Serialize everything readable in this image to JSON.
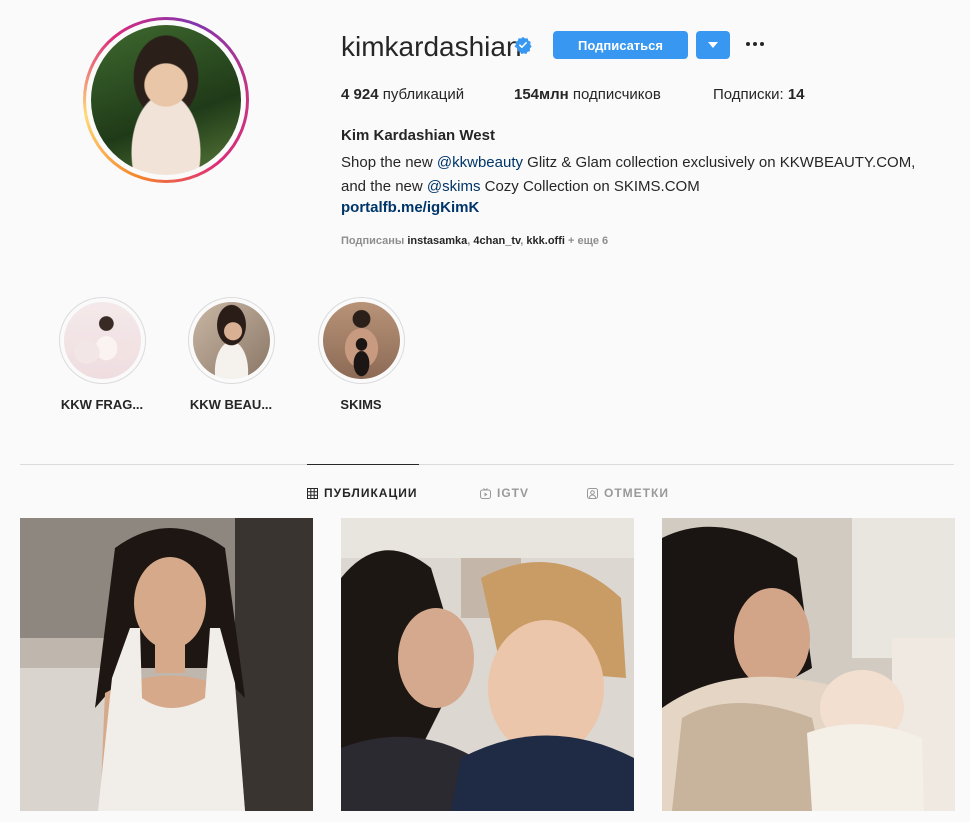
{
  "profile": {
    "username": "kimkardashian",
    "follow_label": "Подписаться",
    "stats": {
      "posts_count": "4 924",
      "posts_label": "публикаций",
      "followers_count": "154млн",
      "followers_label": "подписчиков",
      "following_label": "Подписки:",
      "following_count": "14"
    },
    "full_name": "Kim Kardashian West",
    "bio": {
      "line1_pre": "Shop the new ",
      "line1_mention": "@kkwbeauty",
      "line1_post": " Glitz & Glam collection exclusively on KKWBEAUTY.COM,",
      "line2_pre": "and the new ",
      "line2_mention": "@skims",
      "line2_post": " Cozy Collection on SKIMS.COM"
    },
    "link": "portalfb.me/igKimK",
    "followed_by": {
      "prefix": "Подписаны",
      "accounts": [
        "instasamka",
        "4chan_tv",
        "kkk.offi"
      ],
      "more": "+ еще 6"
    }
  },
  "highlights": [
    {
      "label": "KKW FRAG..."
    },
    {
      "label": "KKW BEAU..."
    },
    {
      "label": "SKIMS"
    }
  ],
  "tabs": [
    {
      "label": "ПУБЛИКАЦИИ",
      "icon": "grid-icon",
      "active": true
    },
    {
      "label": "IGTV",
      "icon": "igtv-icon",
      "active": false
    },
    {
      "label": "ОТМЕТКИ",
      "icon": "tagged-icon",
      "active": false
    }
  ],
  "colors": {
    "accent": "#3897f0",
    "link": "#003569",
    "verified": "#3897f0"
  }
}
